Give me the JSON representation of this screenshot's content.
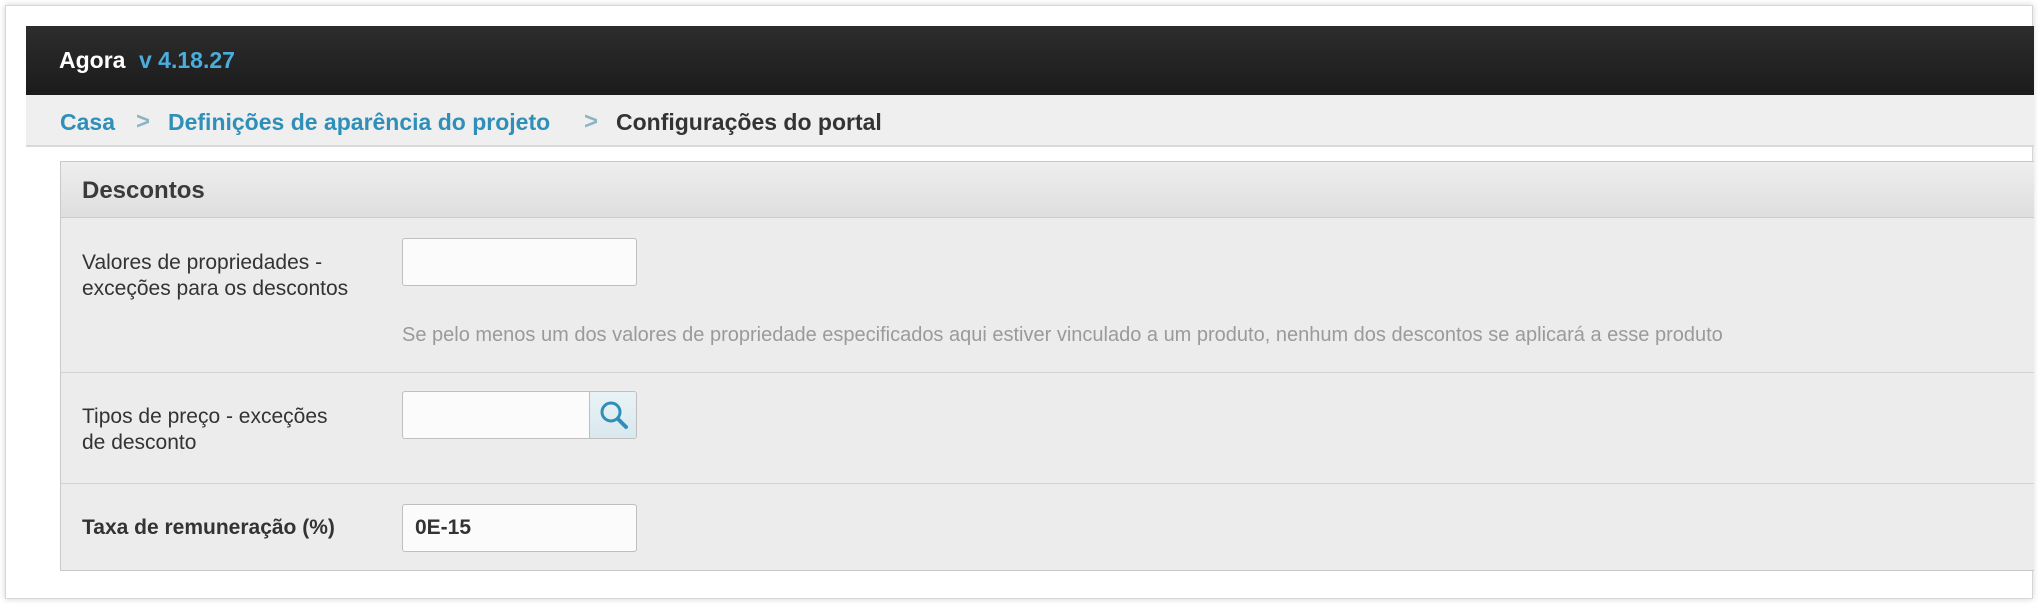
{
  "app": {
    "name": "Agora",
    "version": "v 4.18.27"
  },
  "breadcrumb": {
    "items": [
      {
        "label": "Casa"
      },
      {
        "label": "Definições de aparência do projeto"
      },
      {
        "label": "Configurações do portal"
      }
    ],
    "separator": ">"
  },
  "panel": {
    "title": "Descontos",
    "fields": {
      "property_exceptions": {
        "label_line1": "Valores de propriedades -",
        "label_line2": "exceções para os descontos",
        "value": "",
        "hint": "Se pelo menos um dos valores de propriedade especificados aqui estiver vinculado a um produto, nenhum dos descontos se aplicará a esse produto"
      },
      "price_types": {
        "label_line1": "Tipos de preço - exceções",
        "label_line2": "de desconto",
        "value": "",
        "button_icon": "search-icon"
      },
      "remuneration_rate": {
        "label": "Taxa de remuneração (%)",
        "value": "0E-15"
      }
    }
  },
  "colors": {
    "topbar": "#1b1b1b",
    "version_accent": "#49aedc",
    "link": "#2f8fb9",
    "panel_bg": "#ececec",
    "hint_text": "#9a9a9a"
  }
}
